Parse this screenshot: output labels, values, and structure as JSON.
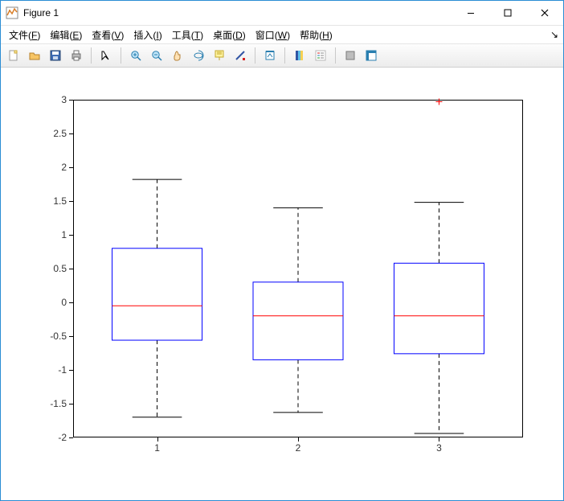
{
  "window": {
    "title": "Figure 1"
  },
  "menus": {
    "file": {
      "label": "文件(F)",
      "accel": "F"
    },
    "edit": {
      "label": "编辑(E)",
      "accel": "E"
    },
    "view": {
      "label": "查看(V)",
      "accel": "V"
    },
    "insert": {
      "label": "插入(I)",
      "accel": "I"
    },
    "tools": {
      "label": "工具(T)",
      "accel": "T"
    },
    "desktop": {
      "label": "桌面(D)",
      "accel": "D"
    },
    "window": {
      "label": "窗口(W)",
      "accel": "W"
    },
    "help": {
      "label": "帮助(H)",
      "accel": "H"
    }
  },
  "toolbar": {
    "new": "New Figure",
    "open": "Open",
    "save": "Save",
    "print": "Print",
    "pointer": "Edit Plot",
    "zoom_in": "Zoom In",
    "zoom_out": "Zoom Out",
    "pan": "Pan",
    "rotate3d": "Rotate 3D",
    "datacursor": "Data Cursor",
    "brush": "Brush",
    "link": "Link Plot",
    "colorbar": "Insert Colorbar",
    "legend": "Insert Legend",
    "hide": "Hide Plot Tools",
    "show": "Show Plot Tools"
  },
  "chart_data": {
    "type": "box",
    "categories": [
      "1",
      "2",
      "3"
    ],
    "series": [
      {
        "name": "1",
        "min": -1.7,
        "q1": -0.56,
        "median": -0.05,
        "q3": 0.8,
        "max": 1.82,
        "outliers": []
      },
      {
        "name": "2",
        "min": -1.63,
        "q1": -0.85,
        "median": -0.2,
        "q3": 0.3,
        "max": 1.4,
        "outliers": []
      },
      {
        "name": "3",
        "min": -1.94,
        "q1": -0.76,
        "median": -0.2,
        "q3": 0.58,
        "max": 1.48,
        "outliers": [
          2.97
        ]
      }
    ],
    "xlabel": "",
    "ylabel": "",
    "ylim": [
      -2,
      3
    ],
    "yticks": [
      -2,
      -1.5,
      -1,
      -0.5,
      0,
      0.5,
      1,
      1.5,
      2,
      2.5,
      3
    ],
    "colors": {
      "box": "#0000ff",
      "median": "#ff0000",
      "whisker": "#000000",
      "outlier": "#ff0000"
    }
  }
}
